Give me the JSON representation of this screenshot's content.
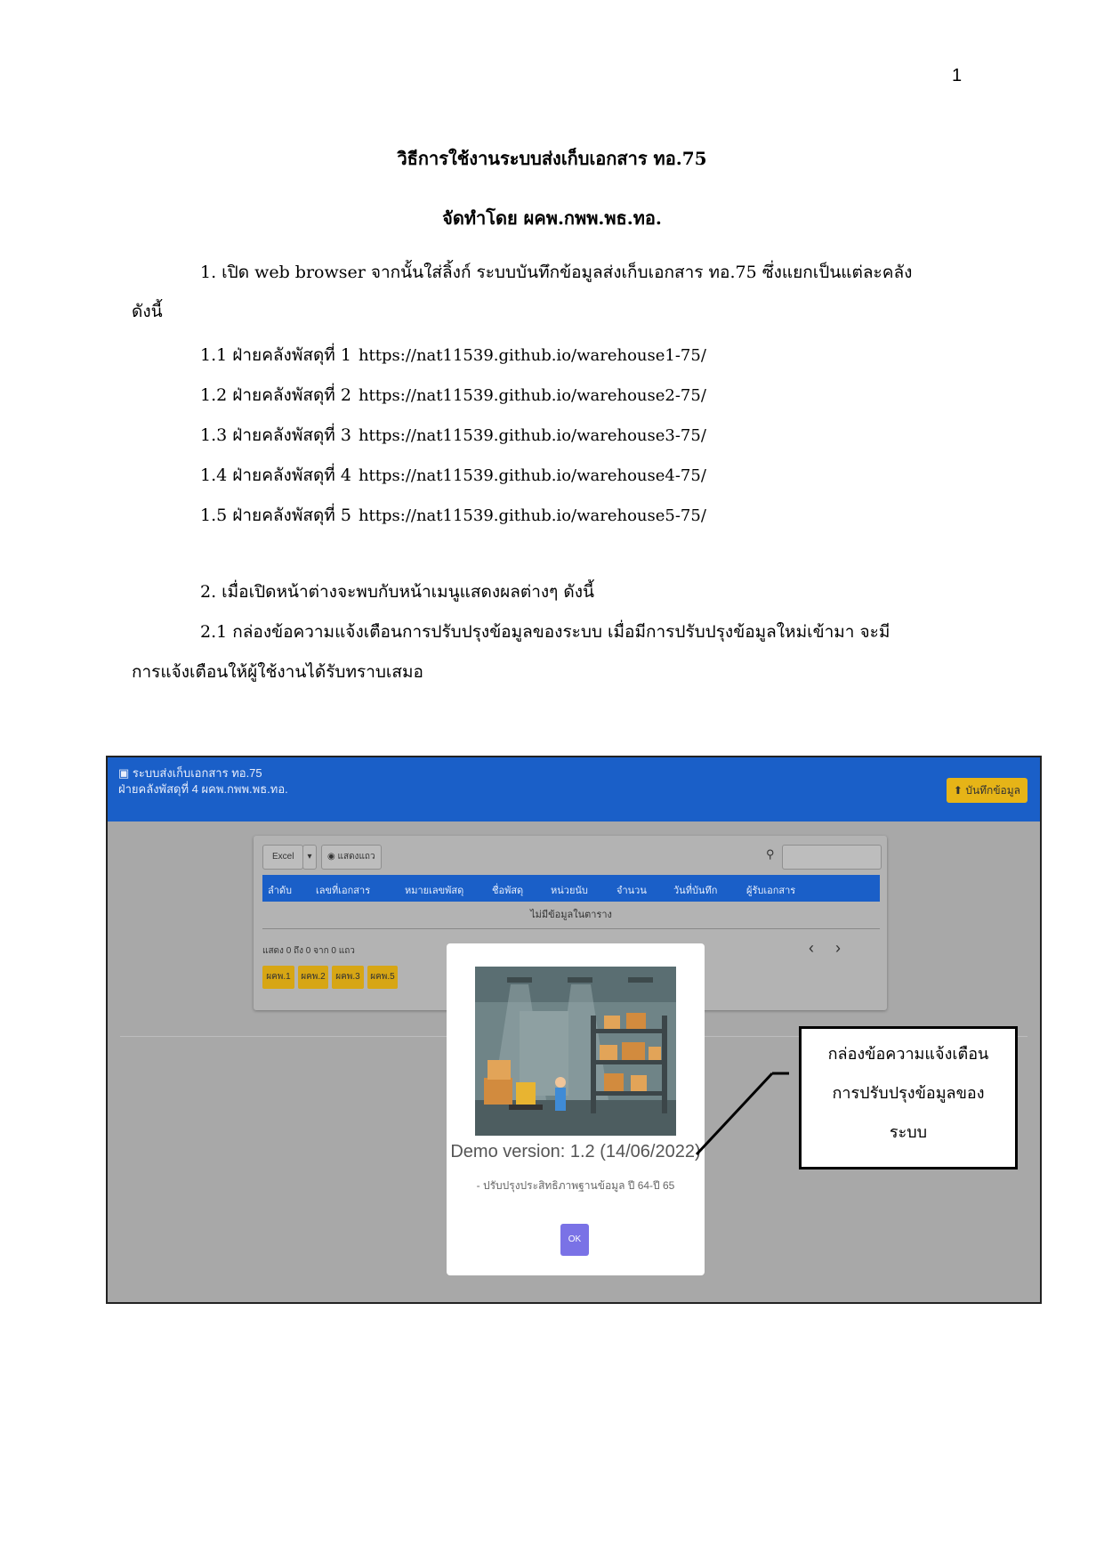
{
  "page_number": "1",
  "title": "วิธีการใช้งานระบบส่งเก็บเอกสาร ทอ.75",
  "author": "จัดทำโดย ผคพ.กพพ.พธ.ทอ.",
  "step1": {
    "text": "1. เปิด web browser จากนั้นใส่ลิ้งก์ ระบบบันทึกข้อมูลส่งเก็บเอกสาร ทอ.75 ซึ่งแยกเป็นแต่ละคลัง",
    "text_cont": "ดังนี้",
    "links": [
      {
        "label": "1.1  ฝ่ายคลังพัสดุที่ 1",
        "url": "https://nat11539.github.io/warehouse1-75/"
      },
      {
        "label": "1.2  ฝ่ายคลังพัสดุที่ 2",
        "url": "https://nat11539.github.io/warehouse2-75/"
      },
      {
        "label": "1.3  ฝ่ายคลังพัสดุที่ 3",
        "url": "https://nat11539.github.io/warehouse3-75/"
      },
      {
        "label": "1.4  ฝ่ายคลังพัสดุที่ 4",
        "url": "https://nat11539.github.io/warehouse4-75/"
      },
      {
        "label": "1.5  ฝ่ายคลังพัสดุที่ 5",
        "url": "https://nat11539.github.io/warehouse5-75/"
      }
    ]
  },
  "step2": {
    "text": "2. เมื่อเปิดหน้าต่างจะพบกับหน้าเมนูแสดงผลต่างๆ ดังนี้",
    "sub_text": "2.1 กล่องข้อความแจ้งเตือนการปรับปรุงข้อมูลของระบบ เมื่อมีการปรับปรุงข้อมูลใหม่เข้ามา จะมี",
    "sub_text_cont": "การแจ้งเตือนให้ผู้ใช้งานได้รับทราบเสมอ"
  },
  "screenshot": {
    "app_title": "ระบบส่งเก็บเอกสาร ทอ.75",
    "app_subtitle": "ฝ่ายคลังพัสดุที่ 4 ผคพ.กพพ.พธ.ทอ.",
    "save_button": "บันทึกข้อมูล",
    "export_select": "Excel",
    "columns_button": "แสดงแถว",
    "table_headers": [
      "ลำดับ",
      "เลขที่เอกสาร",
      "หมายเลขพัสดุ",
      "ชื่อพัสดุ",
      "หน่วยนับ",
      "จำนวน",
      "วันที่บันทึก",
      "ผู้รับเอกสาร"
    ],
    "empty_message": "ไม่มีข้อมูลในตาราง",
    "showing_text": "แสดง 0 ถึง 0 จาก 0 แถว",
    "warehouse_buttons": [
      "ผคพ.1",
      "ผคพ.2",
      "ผคพ.3",
      "ผคพ.5"
    ],
    "modal": {
      "title": "Demo version: 1.2 (14/06/2022)",
      "text": "- ปรับปรุงประสิทธิภาพฐานข้อมูล ปี 64-ปี 65",
      "ok": "OK"
    }
  },
  "callout": {
    "line1": "กล่องข้อความแจ้งเตือน",
    "line2": "การปรับปรุงข้อมูลของ",
    "line3": "ระบบ"
  },
  "colors": {
    "appbar": "#1a5fc8",
    "save_button": "#e6b417",
    "ok_button": "#7a72e6"
  }
}
